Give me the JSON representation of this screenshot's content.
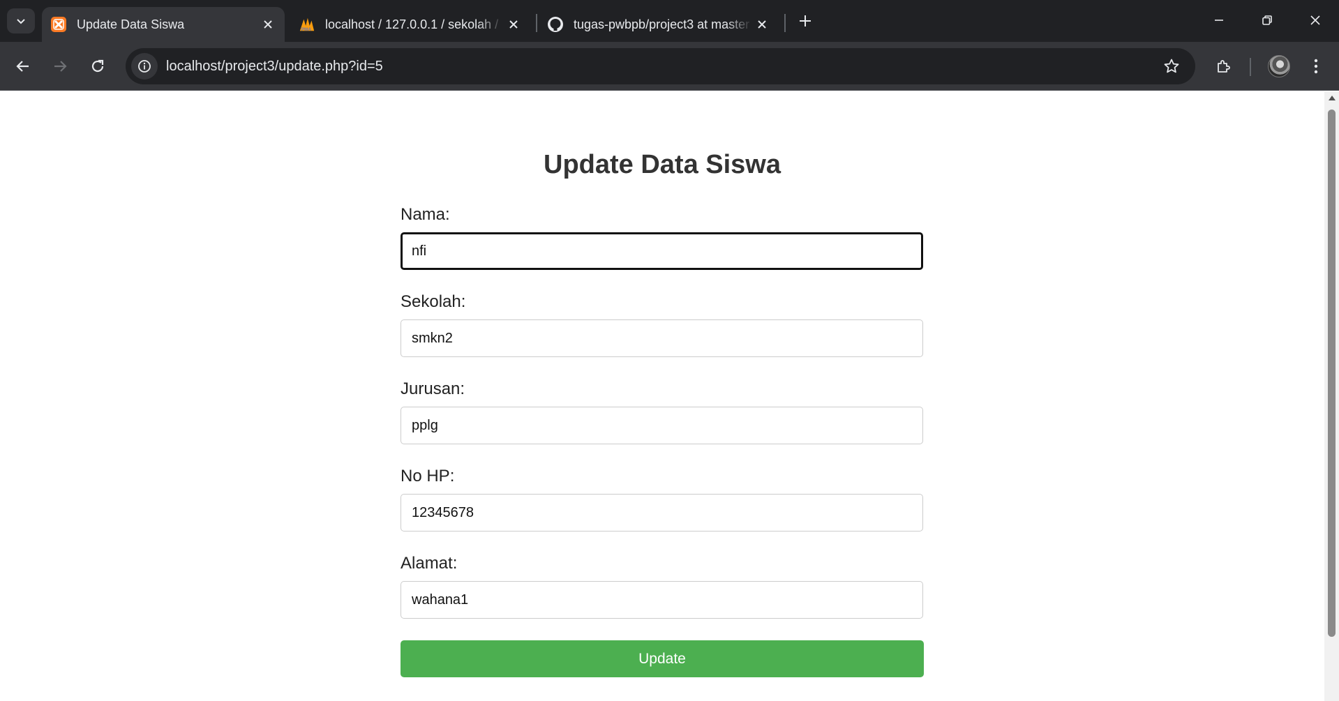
{
  "browser": {
    "tabs": [
      {
        "title": "Update Data Siswa",
        "active": true,
        "icon": "xampp-icon"
      },
      {
        "title": "localhost / 127.0.0.1 / sekolah / ",
        "active": false,
        "icon": "phpmyadmin-icon"
      },
      {
        "title": "tugas-pwbpb/project3 at master",
        "active": false,
        "icon": "github-icon"
      }
    ],
    "url": "localhost/project3/update.php?id=5"
  },
  "form": {
    "heading": "Update Data Siswa",
    "fields": [
      {
        "label": "Nama:",
        "value": "nfi"
      },
      {
        "label": "Sekolah:",
        "value": "smkn2"
      },
      {
        "label": "Jurusan:",
        "value": "pplg"
      },
      {
        "label": "No HP:",
        "value": "12345678"
      },
      {
        "label": "Alamat:",
        "value": "wahana1"
      }
    ],
    "submit_label": "Update"
  },
  "colors": {
    "tabstrip": "#202124",
    "toolbar": "#35363a",
    "button": "#4caf50",
    "heading": "#333333"
  }
}
